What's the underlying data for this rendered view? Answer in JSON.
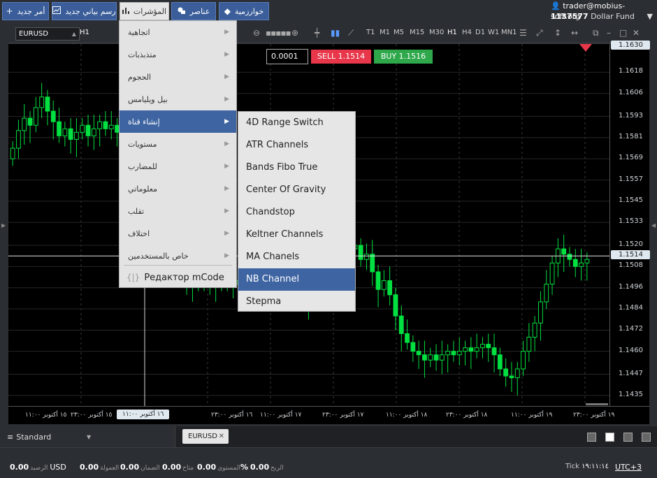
{
  "topbar": {
    "new_order": "أمر جديد",
    "new_chart": "رسم بياني جديد",
    "indicators": "المؤشرات",
    "elements": "عناصر",
    "algorithms": "خوارزمية"
  },
  "account": {
    "email": "trader@mobius-soft.org",
    "number": "1137577",
    "fund": "Dollar Fund"
  },
  "chart_toolbar": {
    "symbol": "EURUSD",
    "timeframe": "H1",
    "timeframes": [
      "T1",
      "M1",
      "M5",
      "M15",
      "M30",
      "H1",
      "H4",
      "D1",
      "W1",
      "MN1"
    ],
    "active_timeframe": "H1"
  },
  "trade_panel": {
    "lot": "0.0001",
    "sell": "SELL 1.1514",
    "buy": "BUY 1.1516",
    "sell_color": "#e8374a",
    "buy_color": "#2ea84b"
  },
  "indicator_menu": [
    "اتجاهية",
    "متذبذبات",
    "الحجوم",
    "بيل ويليامس",
    "إنشاء قناة",
    "مستويات",
    "للمضارب",
    "معلوماتي",
    "تقلب",
    "اختلاف",
    "خاص بالمستخدمين"
  ],
  "indicator_menu_selected": 4,
  "mcode_editor": "Редактор mCode",
  "channel_submenu": [
    "4D Range Switch",
    "ATR Channels",
    "Bands Fibo True",
    "Center Of Gravity",
    "Chandstop",
    "Keltner Channels",
    "MA Chanels",
    "NB Channel",
    "Stepma"
  ],
  "channel_submenu_selected": 7,
  "chart_data": {
    "type": "candlestick",
    "title": "",
    "ylim": [
      1.1429,
      1.1634
    ],
    "y_ticks": [
      "1.1618",
      "1.1606",
      "1.1593",
      "1.1581",
      "1.1569",
      "1.1557",
      "1.1545",
      "1.1533",
      "1.1520",
      "1.1508",
      "1.1496",
      "1.1484",
      "1.1472",
      "1.1460",
      "1.1447",
      "1.1435"
    ],
    "top_price": "1.1630",
    "current_price": "1.1514",
    "x_ticks": [
      "١٥ أكتوبر ١١:٠٠",
      "١٥ أكتوبر ٢٣:٠٠",
      "١٦ أكتوبر ١١:٠٠",
      "١٦ أكتوبر ٢٣:٠٠",
      "١٧ أكتوبر ١١:٠٠",
      "١٧ أكتوبر ٢٣:٠٠",
      "١٨ أكتوبر ١١:٠٠",
      "١٨ أكتوبر ٢٣:٠٠",
      "١٩ أكتوبر ١١:٠٠",
      "١٩ أكتوبر ٢٣:٠٠"
    ],
    "x_cursor": "١٦ أكتوبر ١١:٠٠",
    "bull_color": "#00e040",
    "bear_color": "#00e040",
    "grid": true,
    "close_series": [
      1.1575,
      1.1585,
      1.1592,
      1.1588,
      1.1598,
      1.1604,
      1.1596,
      1.159,
      1.1582,
      1.1586,
      1.158,
      1.1584,
      1.1588,
      1.1582,
      1.1586,
      1.159,
      1.1586,
      1.1588,
      1.1584,
      1.1578,
      1.1582,
      1.1574,
      1.1568,
      1.156,
      1.155,
      1.154,
      1.153,
      1.152,
      1.151,
      1.1505,
      1.15,
      1.1498,
      1.1502,
      1.15,
      1.1504,
      1.1498,
      1.15,
      1.1502,
      1.1498,
      1.15,
      1.1496,
      1.15,
      1.1498,
      1.1502,
      1.15,
      1.1498,
      1.1502,
      1.15,
      1.1498,
      1.15,
      1.1495,
      1.1488,
      1.1498,
      1.1502,
      1.15,
      1.1505,
      1.151,
      1.1515,
      1.1518,
      1.152,
      1.1512,
      1.1515,
      1.1505,
      1.1495,
      1.15,
      1.1492,
      1.148,
      1.147,
      1.1465,
      1.146,
      1.1458,
      1.1455,
      1.1458,
      1.1455,
      1.1458,
      1.146,
      1.1458,
      1.146,
      1.1462,
      1.146,
      1.1462,
      1.1464,
      1.1462,
      1.1458,
      1.145,
      1.1446,
      1.1445,
      1.145,
      1.146,
      1.1468,
      1.1476,
      1.1488,
      1.1498,
      1.151,
      1.1518,
      1.1515,
      1.1512,
      1.1508,
      1.151,
      1.1512
    ]
  },
  "bottom": {
    "workspace": "Standard",
    "tab": "EURUSD"
  },
  "status": {
    "balance_value": "0.00",
    "balance_label": "الرصيد",
    "currency": "USD",
    "commission_value": "0.00",
    "commission_label": "العمولة",
    "margin_value": "0.00",
    "margin_label": "الضمان",
    "available_value": "0.00",
    "available_label": "متاح",
    "level_value": "0.00",
    "level_label": "المستوى",
    "level_unit": "%",
    "profit_value": "0.00",
    "profit_label": "الربح",
    "tick_label": "Tick",
    "tick_time": "١٩:١١:١٤",
    "timezone": "UTC+3"
  }
}
